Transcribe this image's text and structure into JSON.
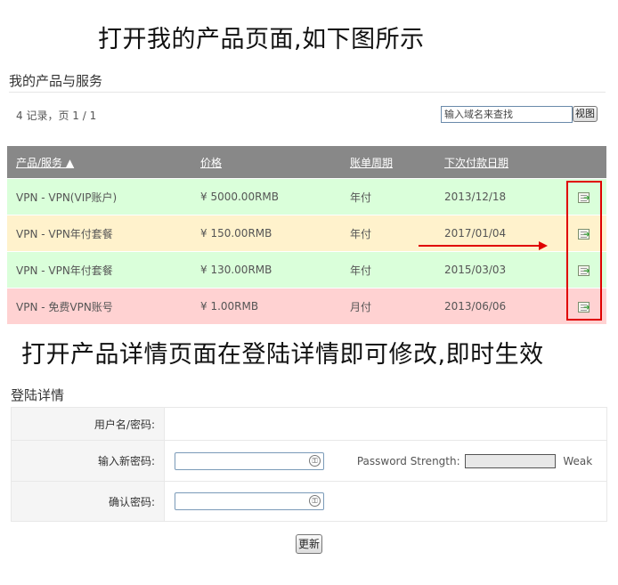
{
  "banner_top": "打开我的产品页面,如下图所示",
  "banner_middle": "打开产品详情页面在登陆详情即可修改,即时生效",
  "products": {
    "title": "我的产品与服务",
    "record_info": "4 记录，页 1 / 1",
    "search_placeholder": "输入域名来查找",
    "search_button": "视图",
    "columns": [
      "产品/服务 ▲",
      "价格",
      "账单周期",
      "下次付款日期"
    ],
    "rows": [
      {
        "name": "VPN - VPN(VIP账户)",
        "price": "¥ 5000.00RMB",
        "cycle": "年付",
        "due": "2013/12/18",
        "status_color": "#daffda"
      },
      {
        "name": "VPN - VPN年付套餐",
        "price": "¥ 150.00RMB",
        "cycle": "年付",
        "due": "2017/01/04",
        "status_color": "#fff2cc"
      },
      {
        "name": "VPN - VPN年付套餐",
        "price": "¥ 130.00RMB",
        "cycle": "年付",
        "due": "2015/03/03",
        "status_color": "#daffda"
      },
      {
        "name": "VPN - 免费VPN账号",
        "price": "¥ 1.00RMB",
        "cycle": "月付",
        "due": "2013/06/06",
        "status_color": "#ffd2d2"
      }
    ],
    "row_action_icon": "view-details-icon"
  },
  "login": {
    "title": "登陆详情",
    "username_label": "用户名/密码:",
    "new_password_label": "输入新密码:",
    "confirm_password_label": "确认密码:",
    "strength_label": "Password Strength:",
    "strength_value": "Weak",
    "update_button": "更新"
  },
  "annotation_color": "#e00000"
}
